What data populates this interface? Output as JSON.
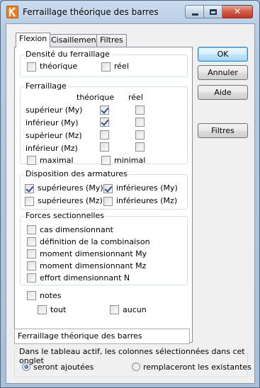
{
  "window": {
    "title": "Ferraillage théorique des barres",
    "controls": {
      "close_glyph": "✕"
    }
  },
  "tabs": [
    "Flexion",
    "Cisaillement",
    "Filtres"
  ],
  "density": {
    "label": "Densité du ferraillage",
    "theorique": {
      "label": "théorique",
      "checked": false
    },
    "reel": {
      "label": "réel",
      "checked": false
    }
  },
  "reinforcement": {
    "label": "Ferraillage",
    "col_theorique": "théorique",
    "col_reel": "réel",
    "rows": [
      {
        "label": "supérieur (My)",
        "theorique": true,
        "reel": false
      },
      {
        "label": "inférieur (My)",
        "theorique": true,
        "reel": false
      },
      {
        "label": "supérieur (Mz)",
        "theorique": false,
        "reel": false
      },
      {
        "label": "inférieur (Mz)",
        "theorique": false,
        "reel": false
      }
    ],
    "maximal": {
      "label": "maximal",
      "checked": false
    },
    "minimal": {
      "label": "minimal",
      "checked": false
    }
  },
  "layout": {
    "label": "Disposition des armatures",
    "sup_my": {
      "label": "supérieures (My)",
      "checked": true
    },
    "inf_my": {
      "label": "inférieures (My)",
      "checked": true
    },
    "sup_mz": {
      "label": "supérieures (Mz)",
      "checked": false
    },
    "inf_mz": {
      "label": "inférieures (Mz)",
      "checked": false
    }
  },
  "forces": {
    "label": "Forces sectionnelles",
    "items": [
      {
        "label": "cas dimensionnant",
        "checked": false
      },
      {
        "label": "définition de la combinaison",
        "checked": false
      },
      {
        "label": "moment dimensionnant My",
        "checked": false
      },
      {
        "label": "moment dimensionnant Mz",
        "checked": false
      },
      {
        "label": "effort dimensionnant N",
        "checked": false
      }
    ]
  },
  "notes": {
    "label": "notes",
    "tout": "tout",
    "aucun": "aucun"
  },
  "name_field": {
    "value": "Ferraillage théorique des barres"
  },
  "columns_group": {
    "label": "Dans le tableau actif, les colonnes sélectionnées dans cet onglet",
    "option_add": "seront ajoutées",
    "option_replace": "remplaceront les existantes",
    "selected": "option_add"
  },
  "buttons": {
    "ok": "OK",
    "cancel": "Annuler",
    "help": "Aide",
    "filters": "Filtres"
  }
}
